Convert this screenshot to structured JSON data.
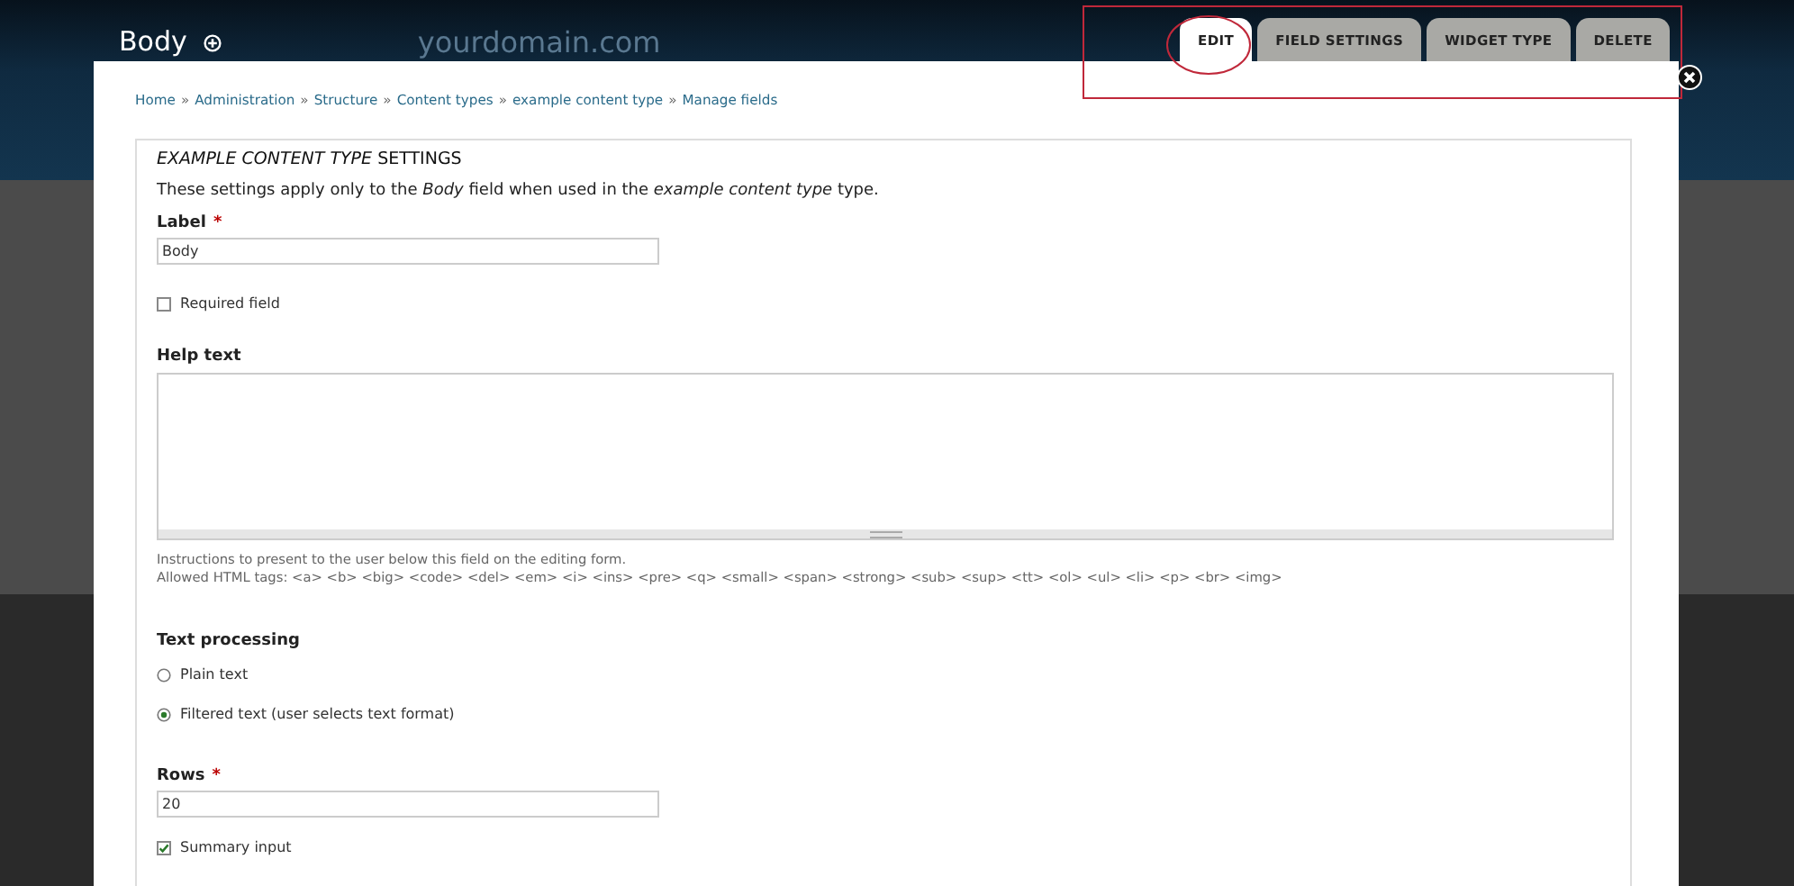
{
  "header": {
    "title": "Body",
    "site_name": "yourdomain.com"
  },
  "tabs": [
    {
      "label": "EDIT",
      "selected": true
    },
    {
      "label": "FIELD SETTINGS",
      "selected": false
    },
    {
      "label": "WIDGET TYPE",
      "selected": false
    },
    {
      "label": "DELETE",
      "selected": false
    }
  ],
  "breadcrumb": {
    "separator": "»",
    "items": [
      "Home",
      "Administration",
      "Structure",
      "Content types",
      "example content type",
      "Manage fields"
    ]
  },
  "fieldset": {
    "legend": "*EXAMPLE CONTENT TYPE* SETTINGS",
    "description": "These settings apply only to the *Body* field when used in the *example content type* type."
  },
  "label_field": {
    "label": "Label",
    "required_mark": "*",
    "value": "Body"
  },
  "required_checkbox": {
    "label": "Required field",
    "checked": false
  },
  "help_text": {
    "label": "Help text",
    "descriptions": [
      "Instructions to present to the user below this field on the editing form.",
      "Allowed HTML tags: <a> <b> <big> <code> <del> <em> <i> <ins> <pre> <q> <small> <span> <strong> <sub> <sup> <tt> <ol> <ul> <li> <p> <br> <img>"
    ]
  },
  "text_processing": {
    "label": "Text processing",
    "options": [
      {
        "label": "Plain text",
        "selected": false
      },
      {
        "label": "Filtered text (user selects text format)",
        "selected": true
      }
    ]
  },
  "rows_field": {
    "label": "Rows",
    "required_mark": "*",
    "value": "20"
  },
  "summary_checkbox": {
    "label": "Summary input",
    "checked": true
  }
}
